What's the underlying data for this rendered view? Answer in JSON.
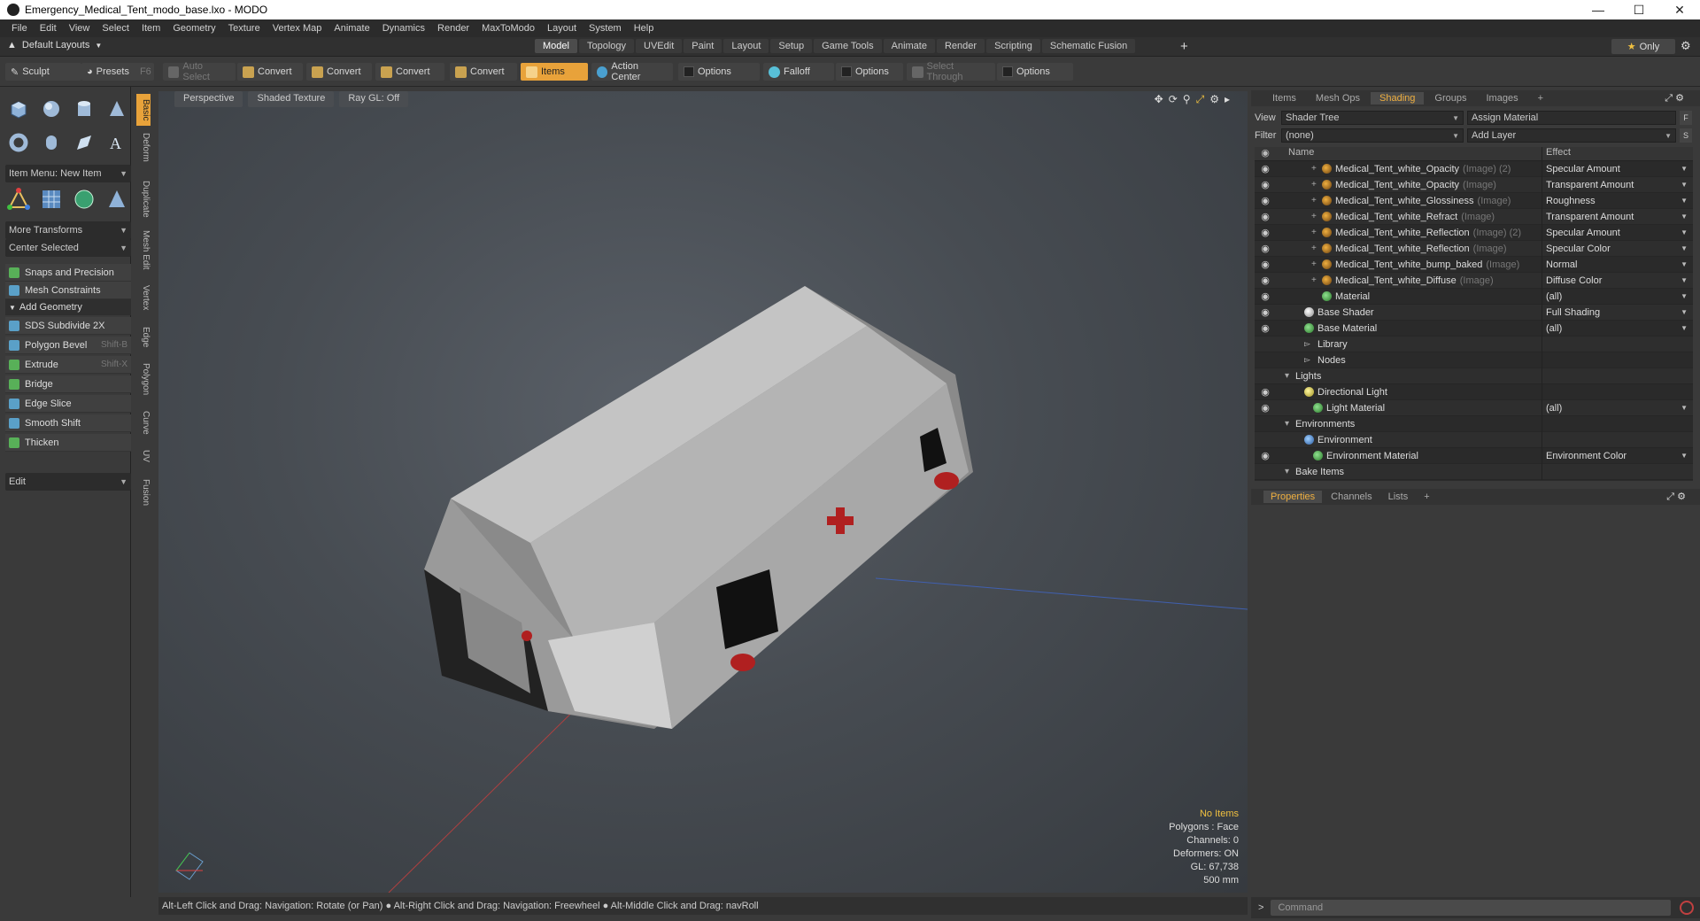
{
  "window": {
    "title": "Emergency_Medical_Tent_modo_base.lxo - MODO"
  },
  "menu": [
    "File",
    "Edit",
    "View",
    "Select",
    "Item",
    "Geometry",
    "Texture",
    "Vertex Map",
    "Animate",
    "Dynamics",
    "Render",
    "MaxToModo",
    "Layout",
    "System",
    "Help"
  ],
  "layout": {
    "default_layouts": "Default Layouts",
    "tabs": [
      "Model",
      "Topology",
      "UVEdit",
      "Paint",
      "Layout",
      "Setup",
      "Game Tools",
      "Animate",
      "Render",
      "Scripting",
      "Schematic Fusion"
    ],
    "active_tab": "Model",
    "only_label": "Only"
  },
  "toolbar": {
    "sculpt": "Sculpt",
    "presets": "Presets",
    "presets_key": "F6",
    "auto_select": "Auto Select",
    "convert1": "Convert",
    "convert2": "Convert",
    "convert3": "Convert",
    "convert4": "Convert",
    "items": "Items",
    "action_center": "Action Center",
    "options1": "Options",
    "falloff": "Falloff",
    "options2": "Options",
    "select_through": "Select Through",
    "options3": "Options"
  },
  "left_panel": {
    "vtabs": [
      "Basic",
      "Deform",
      "Duplicate",
      "Mesh Edit",
      "Vertex",
      "Edge",
      "Polygon",
      "Curve",
      "UV",
      "Fusion"
    ],
    "item_menu": "Item Menu: New Item",
    "more_transforms": "More Transforms",
    "center_selected": "Center Selected",
    "snaps": "Snaps and Precision",
    "mesh_constraints": "Mesh Constraints",
    "add_geometry": "Add Geometry",
    "tools": [
      {
        "label": "SDS Subdivide 2X",
        "key": ""
      },
      {
        "label": "Polygon Bevel",
        "key": "Shift-B"
      },
      {
        "label": "Extrude",
        "key": "Shift-X"
      },
      {
        "label": "Bridge",
        "key": ""
      },
      {
        "label": "Edge Slice",
        "key": ""
      },
      {
        "label": "Smooth Shift",
        "key": ""
      },
      {
        "label": "Thicken",
        "key": ""
      }
    ],
    "edit": "Edit"
  },
  "viewport": {
    "perspective": "Perspective",
    "shaded_texture": "Shaded Texture",
    "ray_gl": "Ray GL: Off",
    "stats": {
      "no_items": "No Items",
      "polygons": "Polygons : Face",
      "channels": "Channels: 0",
      "deformers": "Deformers: ON",
      "gl": "GL: 67,738",
      "scale": "500 mm"
    }
  },
  "statusbar": "Alt-Left Click and Drag: Navigation: Rotate (or Pan) ● Alt-Right Click and Drag: Navigation: Freewheel ● Alt-Middle Click and Drag: navRoll",
  "right_panel": {
    "tabs": [
      "Items",
      "Mesh Ops",
      "Shading",
      "Groups",
      "Images"
    ],
    "active_tab": "Shading",
    "view_label": "View",
    "view_value": "Shader Tree",
    "assign_material": "Assign Material",
    "filter_label": "Filter",
    "filter_value": "(none)",
    "add_layer": "Add Layer",
    "col_name": "Name",
    "col_effect": "Effect",
    "rows": [
      {
        "eye": true,
        "indent": 4,
        "plus": true,
        "icon": "img",
        "name": "Medical_Tent_white_Opacity",
        "sub": "(Image) (2)",
        "effect": "Specular Amount",
        "dd": true
      },
      {
        "eye": true,
        "indent": 4,
        "plus": true,
        "icon": "img",
        "name": "Medical_Tent_white_Opacity",
        "sub": "(Image)",
        "effect": "Transparent Amount",
        "dd": true
      },
      {
        "eye": true,
        "indent": 4,
        "plus": true,
        "icon": "img",
        "name": "Medical_Tent_white_Glossiness",
        "sub": "(Image)",
        "effect": "Roughness",
        "dd": true
      },
      {
        "eye": true,
        "indent": 4,
        "plus": true,
        "icon": "img",
        "name": "Medical_Tent_white_Refract",
        "sub": "(Image)",
        "effect": "Transparent Amount",
        "dd": true
      },
      {
        "eye": true,
        "indent": 4,
        "plus": true,
        "icon": "img",
        "name": "Medical_Tent_white_Reflection",
        "sub": "(Image) (2)",
        "effect": "Specular Amount",
        "dd": true
      },
      {
        "eye": true,
        "indent": 4,
        "plus": true,
        "icon": "img",
        "name": "Medical_Tent_white_Reflection",
        "sub": "(Image)",
        "effect": "Specular Color",
        "dd": true
      },
      {
        "eye": true,
        "indent": 4,
        "plus": true,
        "icon": "img",
        "name": "Medical_Tent_white_bump_baked",
        "sub": "(Image)",
        "effect": "Normal",
        "dd": true
      },
      {
        "eye": true,
        "indent": 4,
        "plus": true,
        "icon": "img",
        "name": "Medical_Tent_white_Diffuse",
        "sub": "(Image)",
        "effect": "Diffuse Color",
        "dd": true
      },
      {
        "eye": true,
        "indent": 4,
        "plus": false,
        "icon": "mat",
        "name": "Material",
        "sub": "",
        "effect": "(all)",
        "dd": true
      },
      {
        "eye": true,
        "indent": 2,
        "plus": false,
        "icon": "shd",
        "name": "Base Shader",
        "sub": "",
        "effect": "Full Shading",
        "dd": true
      },
      {
        "eye": true,
        "indent": 2,
        "plus": false,
        "icon": "mat",
        "name": "Base Material",
        "sub": "",
        "effect": "(all)",
        "dd": true
      },
      {
        "eye": false,
        "indent": 2,
        "plus": false,
        "icon": "fold",
        "name": "Library",
        "sub": "",
        "effect": "",
        "dd": false
      },
      {
        "eye": false,
        "indent": 2,
        "plus": false,
        "icon": "fold",
        "name": "Nodes",
        "sub": "",
        "effect": "",
        "dd": false
      },
      {
        "eye": false,
        "indent": 1,
        "plus": false,
        "icon": "none",
        "name": "Lights",
        "sub": "",
        "effect": "",
        "dd": false
      },
      {
        "eye": true,
        "indent": 2,
        "plus": false,
        "icon": "lgt",
        "name": "Directional Light",
        "sub": "",
        "effect": "",
        "dd": false
      },
      {
        "eye": true,
        "indent": 3,
        "plus": false,
        "icon": "mat",
        "name": "Light Material",
        "sub": "",
        "effect": "(all)",
        "dd": true
      },
      {
        "eye": false,
        "indent": 1,
        "plus": false,
        "icon": "none",
        "name": "Environments",
        "sub": "",
        "effect": "",
        "dd": false
      },
      {
        "eye": false,
        "indent": 2,
        "plus": false,
        "icon": "env",
        "name": "Environment",
        "sub": "",
        "effect": "",
        "dd": false
      },
      {
        "eye": true,
        "indent": 3,
        "plus": false,
        "icon": "mat",
        "name": "Environment Material",
        "sub": "",
        "effect": "Environment Color",
        "dd": true
      },
      {
        "eye": false,
        "indent": 1,
        "plus": false,
        "icon": "none",
        "name": "Bake Items",
        "sub": "",
        "effect": "",
        "dd": false
      }
    ],
    "prop_tabs": [
      "Properties",
      "Channels",
      "Lists"
    ],
    "prop_active": "Properties"
  },
  "command": {
    "placeholder": "Command",
    "prompt": ">"
  },
  "colors": {
    "accent": "#e8a23a",
    "background": "#3a3a3a",
    "viewport": "#4a4f55"
  }
}
